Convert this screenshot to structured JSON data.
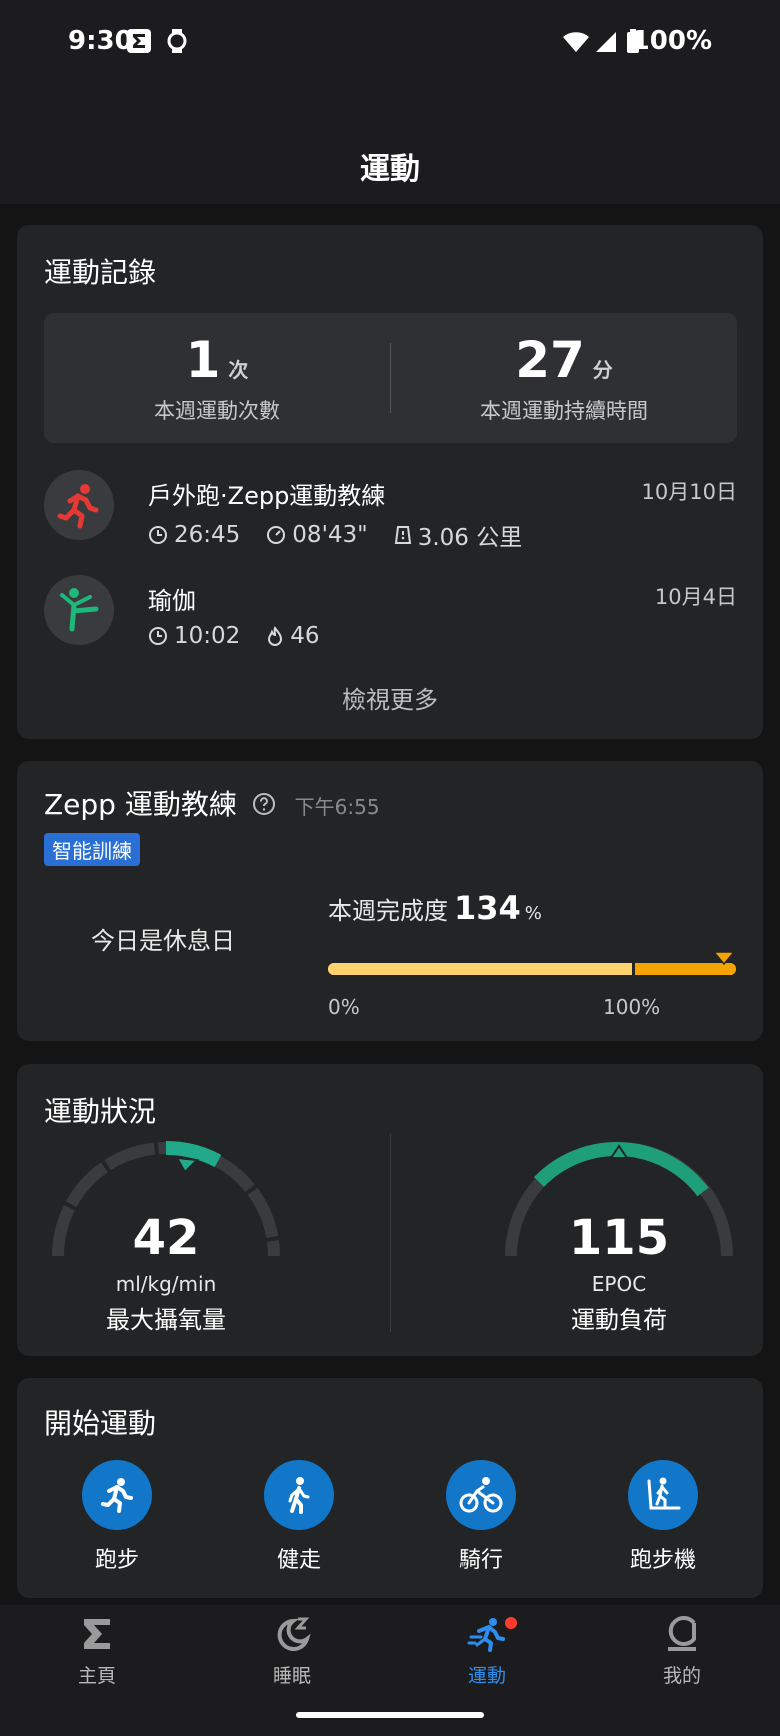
{
  "status": {
    "time": "9:30",
    "battery": "100%"
  },
  "header": {
    "title": "運動"
  },
  "records": {
    "title": "運動記錄",
    "summary": [
      {
        "value": "1",
        "unit": "次",
        "label": "本週運動次數"
      },
      {
        "value": "27",
        "unit": "分",
        "label": "本週運動持續時間"
      }
    ],
    "items": [
      {
        "name": "戶外跑·Zepp運動教練",
        "date": "10月10日",
        "icon": "running-icon",
        "color": "#e53935",
        "stats": [
          {
            "icon": "clock-icon",
            "value": "26:45"
          },
          {
            "icon": "pace-icon",
            "value": "08'43\""
          },
          {
            "icon": "distance-icon",
            "value": "3.06 公里"
          }
        ]
      },
      {
        "name": "瑜伽",
        "date": "10月4日",
        "icon": "yoga-icon",
        "color": "#1db87a",
        "stats": [
          {
            "icon": "clock-icon",
            "value": "10:02"
          },
          {
            "icon": "flame-icon",
            "value": "46"
          }
        ]
      }
    ],
    "more": "檢視更多"
  },
  "coach": {
    "title": "Zepp 運動教練",
    "time": "下午6:55",
    "badge": "智能訓練",
    "rest": "今日是休息日",
    "progress_label": "本週完成度",
    "progress_value": "134",
    "progress_unit": "%",
    "progress_fraction": 1.34,
    "axis_start": "0%",
    "axis_end": "100%"
  },
  "status_card": {
    "title": "運動狀況",
    "vo2": {
      "value": "42",
      "unit": "ml/kg/min",
      "label": "最大攝氧量"
    },
    "load": {
      "value": "115",
      "unit": "EPOC",
      "label": "運動負荷"
    }
  },
  "start": {
    "title": "開始運動",
    "sports": [
      {
        "label": "跑步",
        "icon": "running-icon"
      },
      {
        "label": "健走",
        "icon": "walking-icon"
      },
      {
        "label": "騎行",
        "icon": "cycling-icon"
      },
      {
        "label": "跑步機",
        "icon": "treadmill-icon"
      }
    ]
  },
  "nav": [
    {
      "label": "主頁",
      "icon": "sigma-icon"
    },
    {
      "label": "睡眠",
      "icon": "moon-icon"
    },
    {
      "label": "運動",
      "icon": "workout-icon",
      "active": true
    },
    {
      "label": "我的",
      "icon": "profile-icon"
    }
  ],
  "colors": {
    "accent": "#2c8ff0",
    "teal": "#21a98a",
    "progress": "#ffc24a",
    "sport_button": "#1377c9"
  }
}
